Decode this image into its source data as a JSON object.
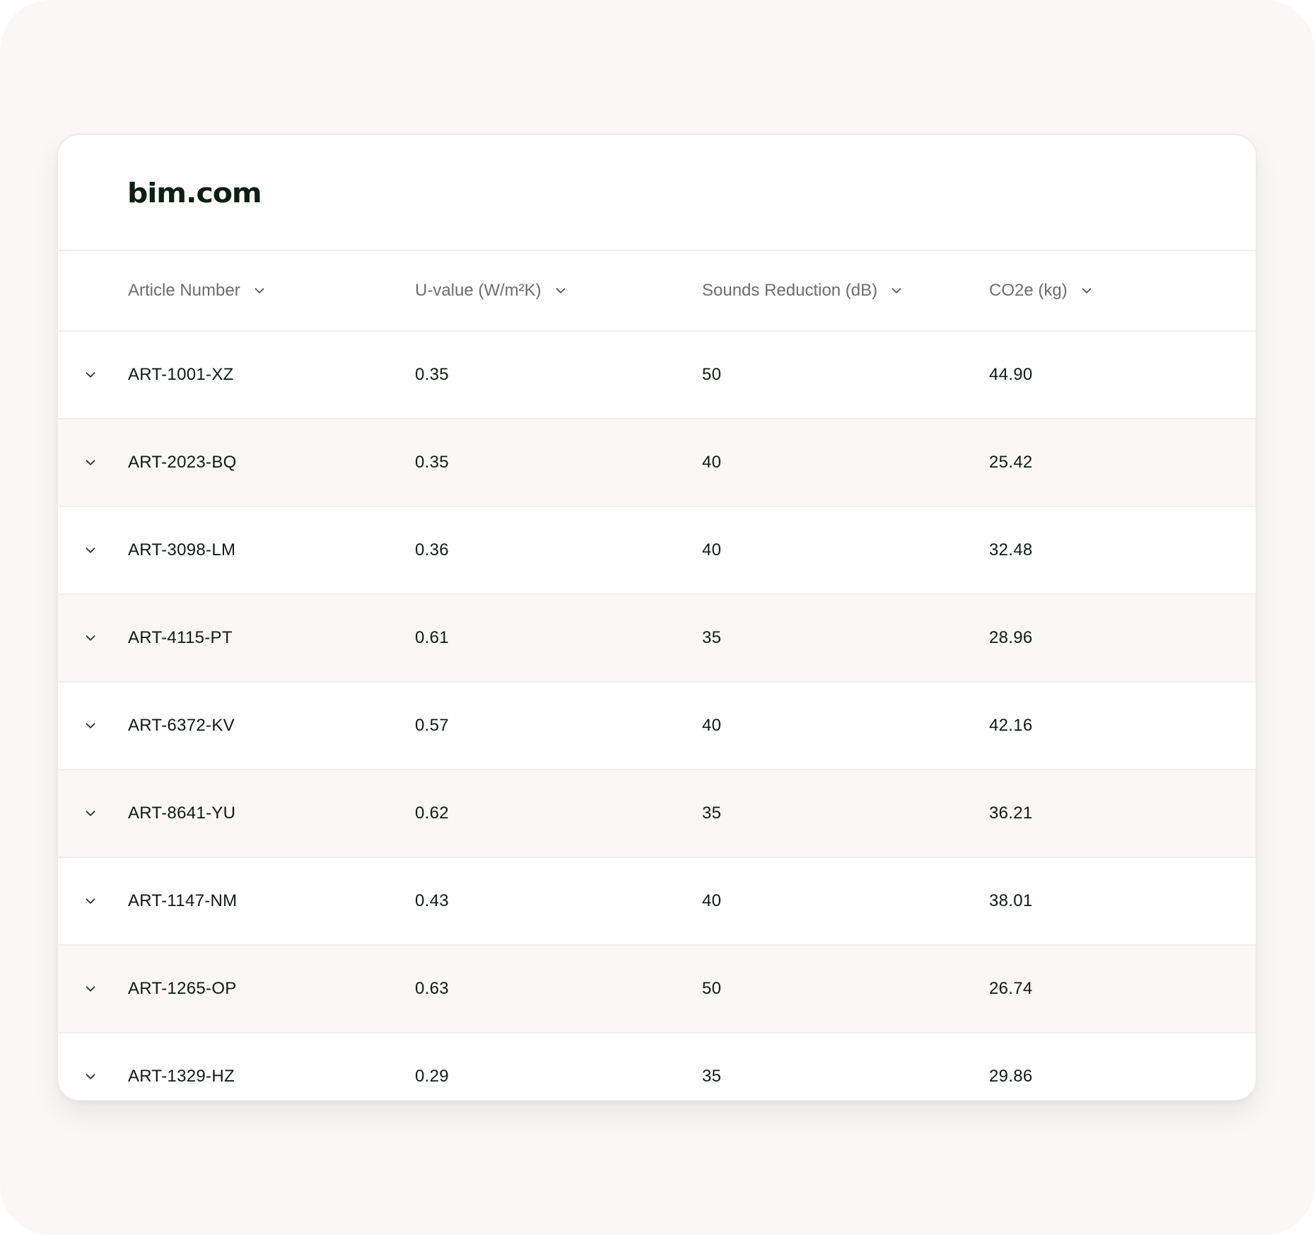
{
  "brand": {
    "logo_text": "bim.com"
  },
  "table": {
    "columns": [
      {
        "label": "Article Number"
      },
      {
        "label": "U-value (W/m²K)"
      },
      {
        "label": "Sounds Reduction (dB)"
      },
      {
        "label": "CO2e (kg)"
      }
    ],
    "sort_icon": "chevron-down-icon",
    "row_expand_icon": "chevron-down-icon",
    "rows": [
      {
        "article": "ART-1001-XZ",
        "u_value": "0.35",
        "sound": "50",
        "co2e": "44.90"
      },
      {
        "article": "ART-2023-BQ",
        "u_value": "0.35",
        "sound": "40",
        "co2e": "25.42"
      },
      {
        "article": "ART-3098-LM",
        "u_value": "0.36",
        "sound": "40",
        "co2e": "32.48"
      },
      {
        "article": "ART-4115-PT",
        "u_value": "0.61",
        "sound": "35",
        "co2e": "28.96"
      },
      {
        "article": "ART-6372-KV",
        "u_value": "0.57",
        "sound": "40",
        "co2e": "42.16"
      },
      {
        "article": "ART-8641-YU",
        "u_value": "0.62",
        "sound": "35",
        "co2e": "36.21"
      },
      {
        "article": "ART-1147-NM",
        "u_value": "0.43",
        "sound": "40",
        "co2e": "38.01"
      },
      {
        "article": "ART-1265-OP",
        "u_value": "0.63",
        "sound": "50",
        "co2e": "26.74"
      },
      {
        "article": "ART-1329-HZ",
        "u_value": "0.29",
        "sound": "35",
        "co2e": "29.86"
      }
    ]
  },
  "colors": {
    "background": "#f9f8f6",
    "card": "#ffffff",
    "row_alt": "#f9f8f6",
    "text": "#0f1a12",
    "header_text": "#6a6f6b",
    "border": "#efefed"
  }
}
